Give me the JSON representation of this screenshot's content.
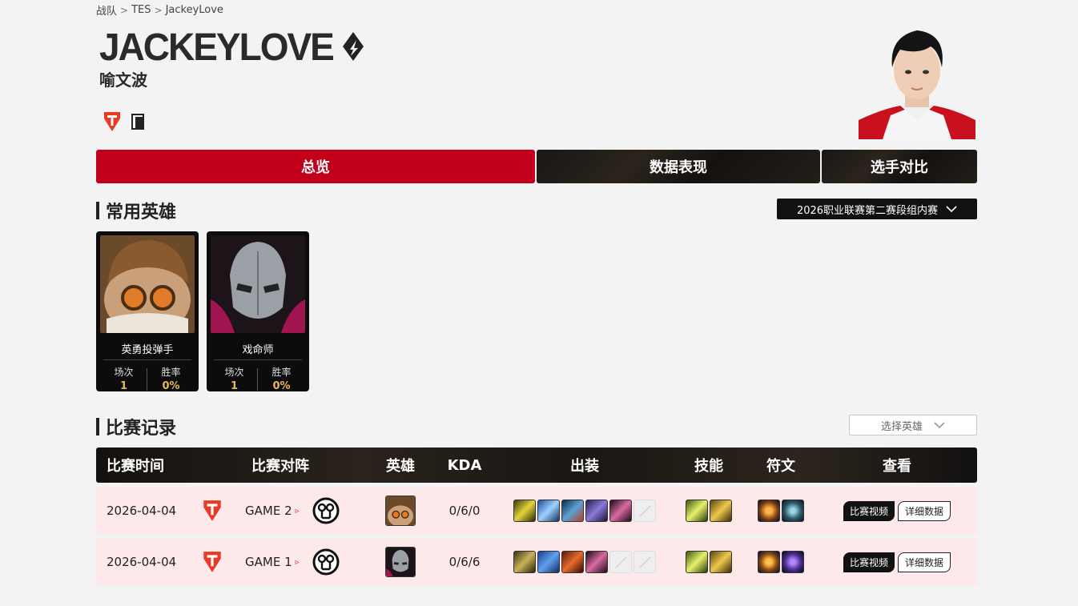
{
  "breadcrumb": {
    "root": "战队",
    "team": "TES",
    "player": "JackeyLove"
  },
  "player": {
    "name": "JACKEYLOVE",
    "real_name": "喻文波"
  },
  "tabs": [
    {
      "label": "总览",
      "active": true
    },
    {
      "label": "数据表现"
    },
    {
      "label": "选手对比"
    }
  ],
  "heroes_section": {
    "title": "常用英雄",
    "season": "2026职业联赛第二赛段组内赛",
    "cards": [
      {
        "name": "英勇投弹手",
        "games_label": "场次",
        "games": "1",
        "winrate_label": "胜率",
        "winrate": "0%"
      },
      {
        "name": "戏命师",
        "games_label": "场次",
        "games": "1",
        "winrate_label": "胜率",
        "winrate": "0%"
      }
    ]
  },
  "records_section": {
    "title": "比赛记录",
    "hero_filter": "选择英雄",
    "headers": {
      "time": "比赛时间",
      "match": "比赛对阵",
      "hero": "英雄",
      "kda": "KDA",
      "items": "出装",
      "skills": "技能",
      "runes": "符文",
      "view": "查看"
    },
    "rows": [
      {
        "date": "2026-04-04",
        "game": "GAME 2",
        "kda": "0/6/0",
        "video": "比赛视频",
        "detail": "详细数据"
      },
      {
        "date": "2026-04-04",
        "game": "GAME 1",
        "kda": "0/6/6",
        "video": "比赛视频",
        "detail": "详细数据"
      }
    ]
  },
  "colors": {
    "accent": "#c3001b",
    "dark": "#111111",
    "row_bg": "#fde9e9",
    "gold": "#e8b957"
  }
}
